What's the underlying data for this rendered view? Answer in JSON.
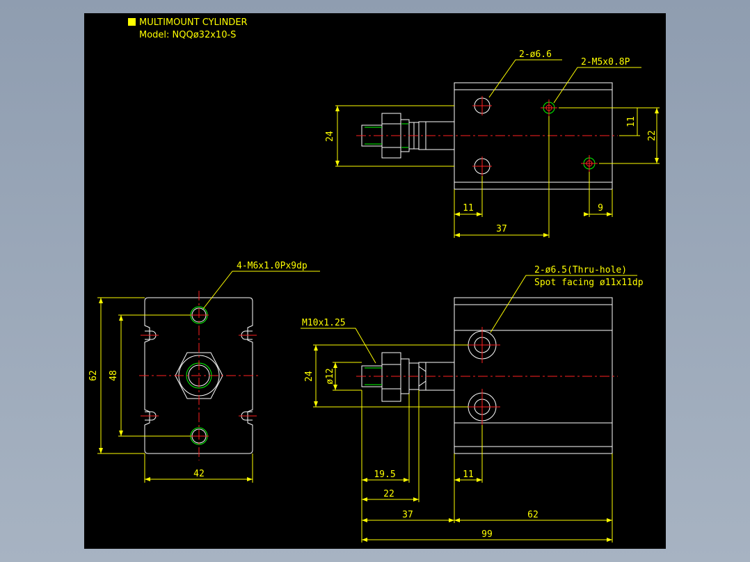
{
  "title": {
    "name": "MULTIMOUNT CYLINDER",
    "model": "Model: NQQø32x10-S"
  },
  "top_view": {
    "hole_label": "2-ø6.6",
    "thread_label": "2-M5x0.8P",
    "dim_height": "24",
    "dim_11_vert": "11",
    "dim_22_vert": "22",
    "dim_11_horiz": "11",
    "dim_9_horiz": "9",
    "dim_37": "37"
  },
  "end_view": {
    "thread_label": "4-M6x1.0Px9dp",
    "dim_62": "62",
    "dim_48": "48",
    "dim_42": "42"
  },
  "side_view": {
    "thru_hole_label": "2-ø6.5(Thru-hole)",
    "spot_facing_label": "Spot facing ø11x11dp",
    "rod_thread_label": "M10x1.25",
    "dim_24": "24",
    "dim_dia12": "ø12",
    "dim_19_5": "19.5",
    "dim_22": "22",
    "dim_11": "11",
    "dim_37": "37",
    "dim_62": "62",
    "dim_99": "99"
  },
  "colors": {
    "background": "#000000",
    "outline": "#ffffff",
    "dimension": "#ffff00",
    "centerline": "#ff2020",
    "thread": "#00ff00"
  }
}
